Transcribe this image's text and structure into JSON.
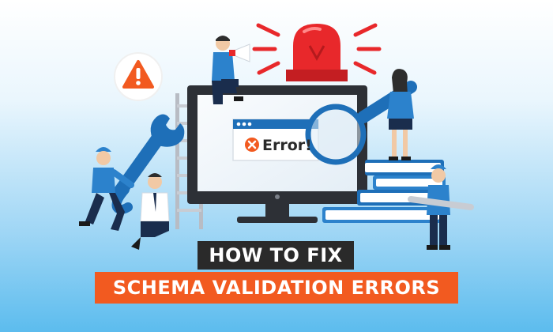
{
  "headline": {
    "line1": "HOW TO FIX",
    "line2": "SCHEMA VALIDATION ERRORS"
  },
  "error_window": {
    "label": "Error!"
  },
  "colors": {
    "accent_orange": "#f25a20",
    "headline_dark": "#2a2a2a",
    "siren_red": "#e8282b",
    "tool_blue": "#1e6fb8"
  },
  "icons": [
    "warning-icon",
    "megaphone-icon",
    "siren-icon",
    "wrench-icon",
    "magnifier-icon",
    "ladder-icon",
    "books-icon",
    "close-icon"
  ]
}
